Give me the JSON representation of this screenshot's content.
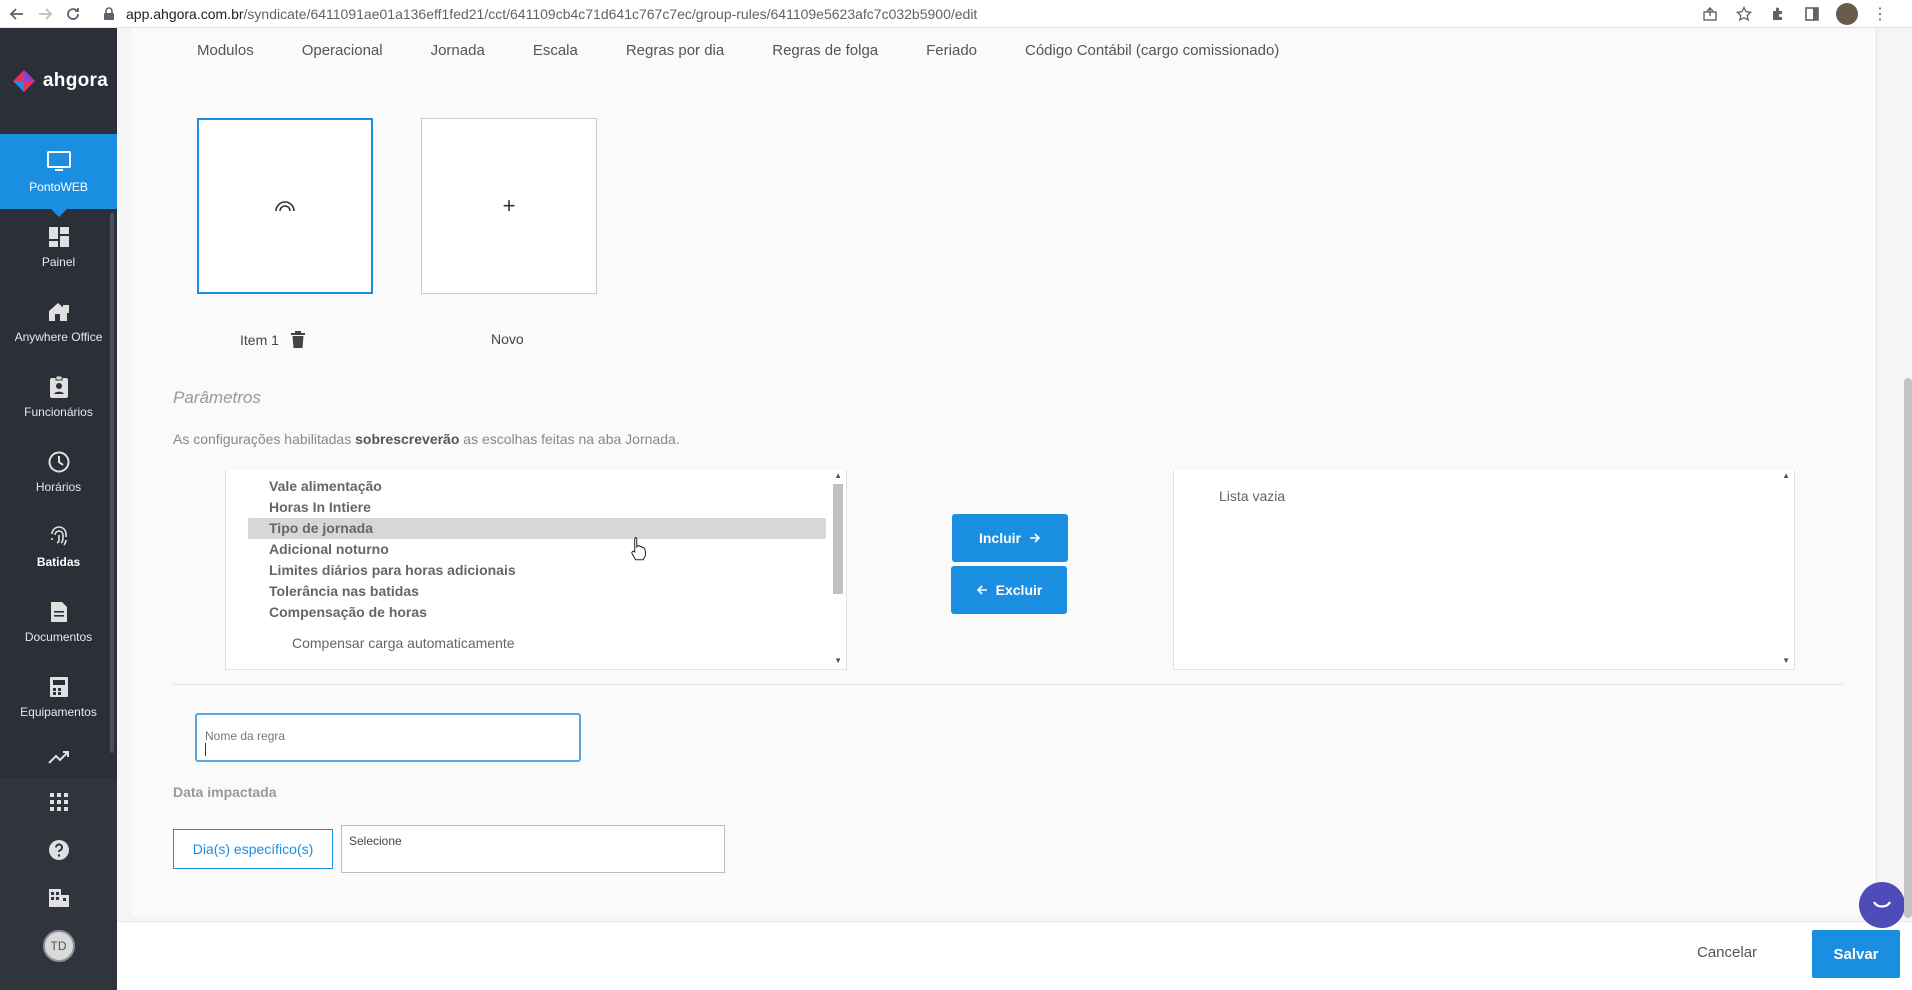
{
  "browser": {
    "url_host": "app.ahgora.com.br",
    "url_path": "/syndicate/6411091ae01a136eff1fed21/cct/641109cb4c71d641c767c7ec/group-rules/641109e5623afc7c032b5900/edit"
  },
  "brand": {
    "name": "ahgora",
    "accent": "#1a8ee0"
  },
  "sidebar": {
    "items": [
      {
        "label": "PontoWEB",
        "icon": "monitor-icon"
      },
      {
        "label": "Painel",
        "icon": "dashboard-icon"
      },
      {
        "label": "Anywhere Office",
        "icon": "home-office-icon"
      },
      {
        "label": "Funcionários",
        "icon": "badge-icon"
      },
      {
        "label": "Horários",
        "icon": "clock-icon"
      },
      {
        "label": "Batidas",
        "icon": "fingerprint-icon"
      },
      {
        "label": "Documentos",
        "icon": "document-icon"
      },
      {
        "label": "Equipamentos",
        "icon": "equipment-icon"
      }
    ],
    "user_initials": "TD"
  },
  "tabs": [
    "Modulos",
    "Operacional",
    "Jornada",
    "Escala",
    "Regras por dia",
    "Regras de folga",
    "Feriado",
    "Código Contábil (cargo comissionado)"
  ],
  "tiles": {
    "item1_label": "Item 1",
    "new_label": "Novo",
    "new_symbol": "+"
  },
  "params": {
    "title": "Parâmetros",
    "desc_before": "As configurações habilitadas ",
    "desc_bold": "sobrescreverão",
    "desc_after": " as escolhas feitas na aba Jornada.",
    "available": [
      "Vale alimentação",
      "Horas In Intiere",
      "Tipo de jornada",
      "Adicional noturno",
      "Limites diários para horas adicionais",
      "Tolerância nas batidas",
      "Compensação de horas"
    ],
    "available_sub": "Compensar carga automaticamente",
    "selected_empty": "Lista vazia",
    "include_label": "Incluir",
    "exclude_label": "Excluir"
  },
  "form": {
    "rule_name_placeholder": "Nome da regra",
    "date_label": "Data impactada",
    "specific_days_label": "Dia(s) específico(s)",
    "select_placeholder": "Selecione"
  },
  "footer": {
    "cancel_label": "Cancelar",
    "save_label": "Salvar"
  }
}
